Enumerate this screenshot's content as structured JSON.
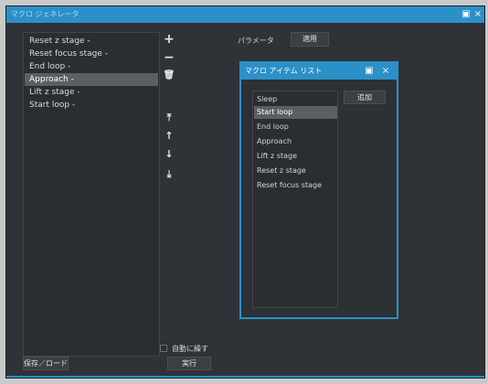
{
  "window": {
    "title": "マクロ ジェネレータ",
    "restore_icon": "restore-window-icon",
    "close_icon": "close-icon"
  },
  "macro_list": {
    "items": [
      {
        "label": "Reset z stage -",
        "selected": false
      },
      {
        "label": "Reset focus stage -",
        "selected": false
      },
      {
        "label": "End loop -",
        "selected": false
      },
      {
        "label": "Approach -",
        "selected": true
      },
      {
        "label": "Lift z stage -",
        "selected": false
      },
      {
        "label": "Start loop -",
        "selected": false
      }
    ]
  },
  "toolbar": {
    "add": "+",
    "remove": "−",
    "delete": "🗑",
    "move_top": "⤒",
    "move_up": "↑",
    "move_down": "↓",
    "move_bottom": "⤓"
  },
  "parameter": {
    "label": "パラメータ",
    "apply_button": "適用"
  },
  "footer": {
    "save_load_button": "保存／ロード",
    "repeat_label": "自動に繰す",
    "run_button": "実行"
  },
  "dialog": {
    "title": "マクロ アイテム リスト",
    "add_button": "追加",
    "items": [
      {
        "label": "Sleep",
        "selected": false
      },
      {
        "label": "Start loop",
        "selected": true
      },
      {
        "label": "End loop",
        "selected": false
      },
      {
        "label": "Approach",
        "selected": false
      },
      {
        "label": "Lift z stage",
        "selected": false
      },
      {
        "label": "Reset z stage",
        "selected": false
      },
      {
        "label": "Reset focus stage",
        "selected": false
      }
    ]
  }
}
